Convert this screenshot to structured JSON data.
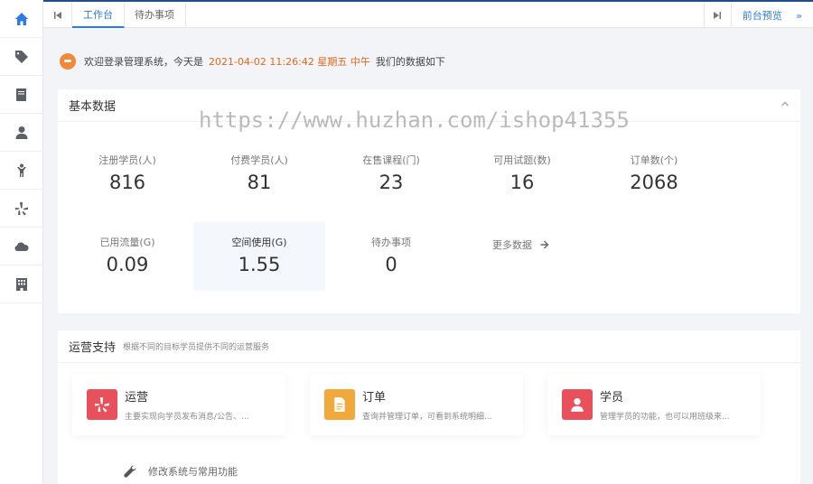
{
  "sidebar": {
    "items": [
      {
        "icon": "home-icon",
        "active": true
      },
      {
        "icon": "tag-icon"
      },
      {
        "icon": "book-icon"
      },
      {
        "icon": "user-icon"
      },
      {
        "icon": "child-icon"
      },
      {
        "icon": "yelp-icon"
      },
      {
        "icon": "cloud-icon"
      },
      {
        "icon": "building-icon"
      }
    ]
  },
  "topbar": {
    "tabs": [
      {
        "label": "工作台"
      },
      {
        "label": "待办事项"
      }
    ],
    "preview_label": "前台预览",
    "preview_suffix": "»"
  },
  "welcome": {
    "prefix": "欢迎登录管理系统，今天是",
    "datetime": "2021-04-02 11:26:42 星期五 中午",
    "suffix": "我们的数据如下"
  },
  "basic": {
    "title": "基本数据",
    "stats": [
      {
        "label": "注册学员(人)",
        "value": "816"
      },
      {
        "label": "付费学员(人)",
        "value": "81"
      },
      {
        "label": "在售课程(门)",
        "value": "23"
      },
      {
        "label": "可用试题(数)",
        "value": "16"
      },
      {
        "label": "订单数(个)",
        "value": "2068"
      },
      {
        "label": "已用流量(G)",
        "value": "0.09"
      },
      {
        "label": "空间使用(G)",
        "value": "1.55"
      },
      {
        "label": "待办事项",
        "value": "0"
      }
    ],
    "more_label": "更多数据"
  },
  "watermark": "https://www.huzhan.com/ishop41355",
  "ops": {
    "title": "运营支持",
    "subtitle": "根据不同的目标学员提供不同的运营服务",
    "cards": [
      {
        "title": "运营",
        "desc": "主要实现向学员发布消息/公告、...",
        "color": "#e8505b",
        "icon": "yelp-icon"
      },
      {
        "title": "订单",
        "desc": "查询并管理订单，可看到系统明细...",
        "color": "#f2a93b",
        "icon": "file-icon"
      },
      {
        "title": "学员",
        "desc": "管理学员的功能，也可以用班级来...",
        "color": "#e8505b",
        "icon": "user-icon"
      }
    ],
    "system_label": "修改系统与常用功能"
  },
  "colors": {
    "accent": "#2d7be5",
    "highlight": "#e0681c"
  }
}
